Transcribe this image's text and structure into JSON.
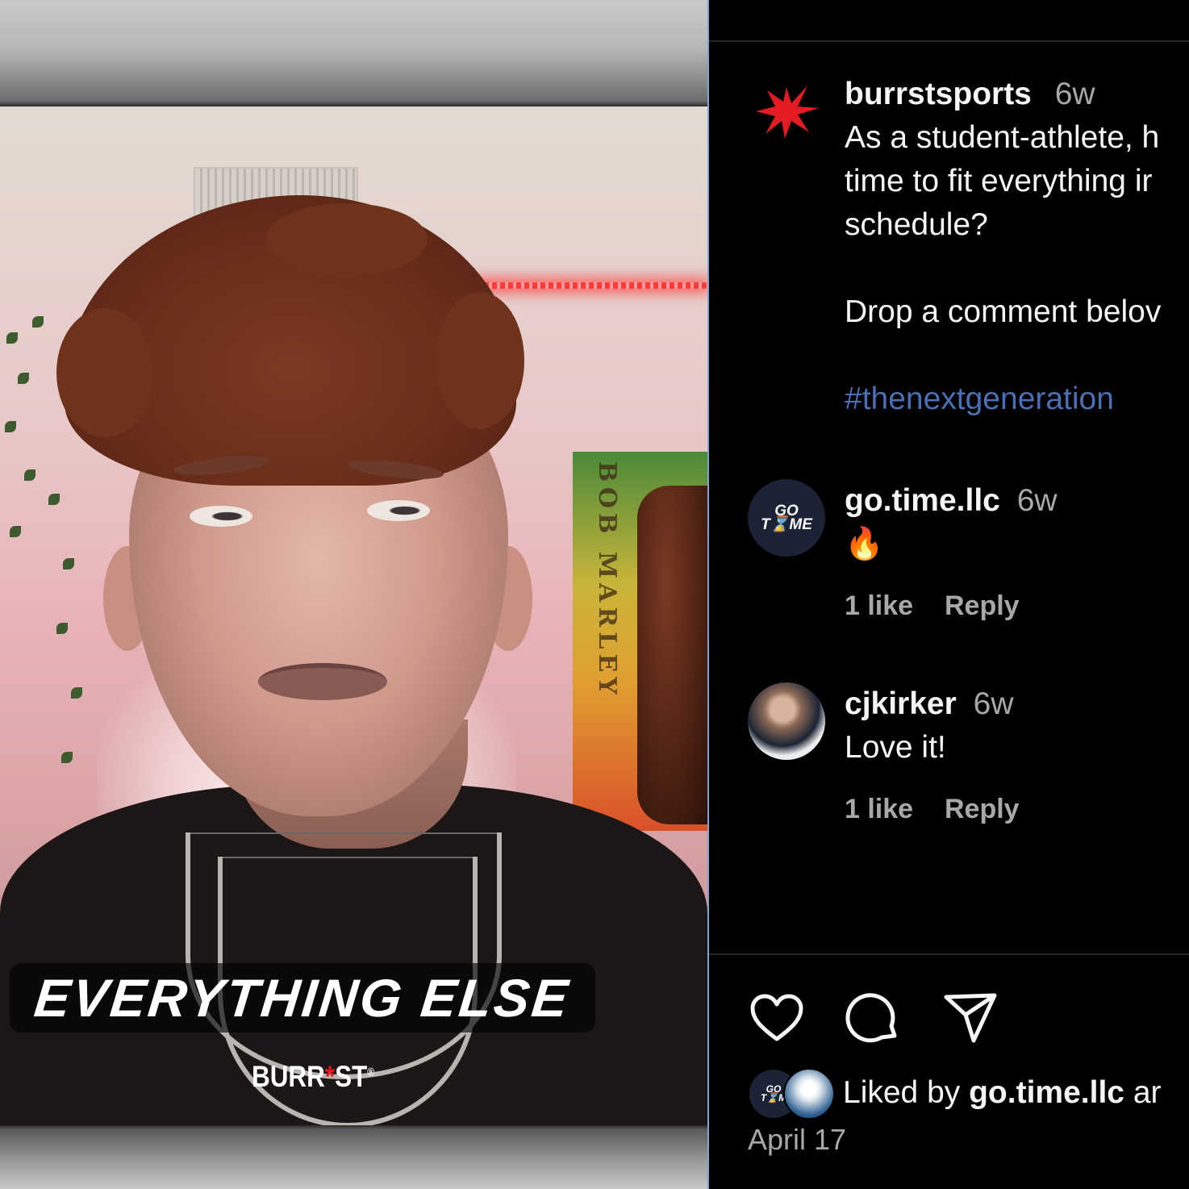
{
  "video": {
    "caption_overlay": "EVERYTHING ELSE",
    "watermark": {
      "prefix": "BURR",
      "mark": "*",
      "suffix": "ST",
      "trademark": "®"
    },
    "poster_text": "BOB MARLEY"
  },
  "post": {
    "author": "burrstsports",
    "time": "6w",
    "caption_lines": [
      "As a student-athlete, h",
      "time to fit everything ir",
      "schedule?",
      "",
      "Drop a comment belov"
    ],
    "hashtag": "#thenextgeneration"
  },
  "comments": [
    {
      "user": "go.time.llc",
      "time": "6w",
      "text": "🔥",
      "likes": "1 like",
      "reply": "Reply"
    },
    {
      "user": "cjkirker",
      "time": "6w",
      "text": "Love it!",
      "likes": "1 like",
      "reply": "Reply"
    }
  ],
  "footer": {
    "liked_prefix": "Liked by",
    "liked_user": "go.time.llc",
    "liked_suffix": " ar",
    "date": "April 17"
  },
  "icons": {
    "author_avatar": "red-spark-icon",
    "like": "heart-icon",
    "comment": "comment-bubble-icon",
    "share": "paper-plane-icon"
  },
  "colors": {
    "background": "#000000",
    "hashtag": "#4a6fb5",
    "secondary_text": "#a8a8a8",
    "brand_red": "#e31b23",
    "divider": "#7da3d1"
  }
}
